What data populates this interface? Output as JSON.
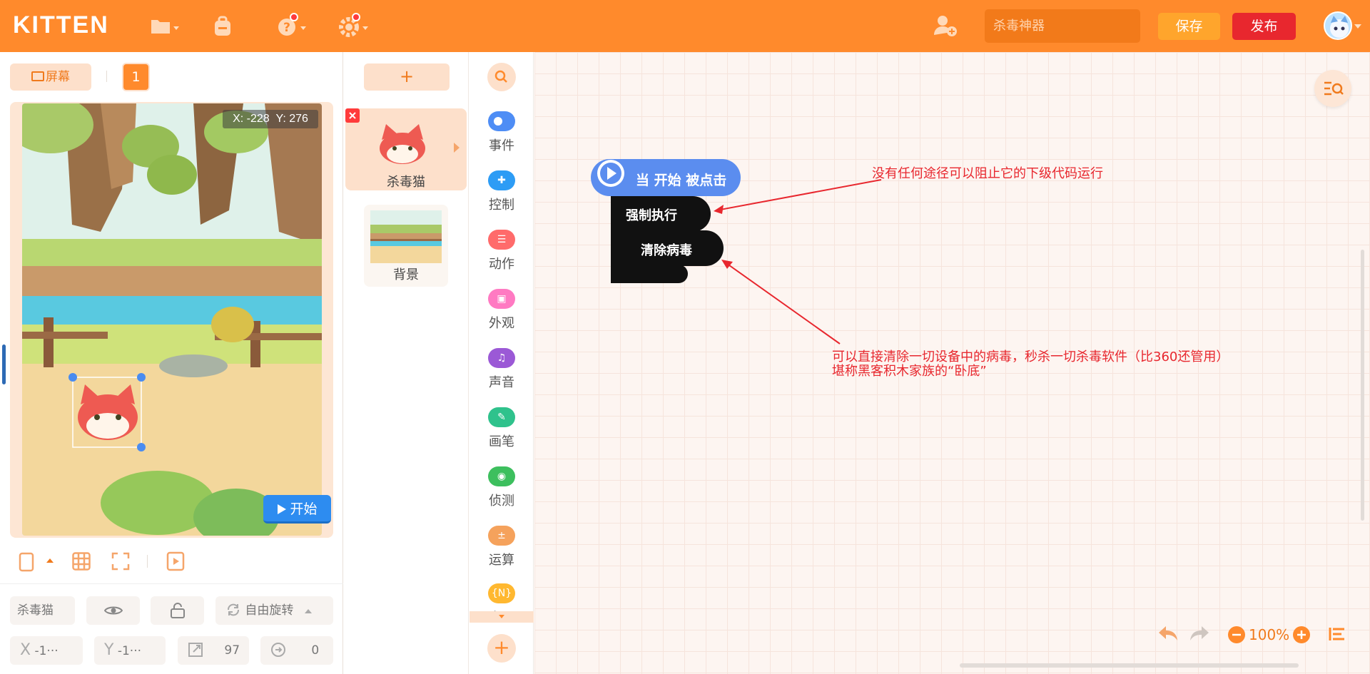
{
  "app": {
    "logo": "KITTEN",
    "project_name": "杀毒神器",
    "save_label": "保存",
    "publish_label": "发布"
  },
  "stage": {
    "screen_label": "屏幕",
    "screen_number": "1",
    "coord_x": "X: -228",
    "coord_y": "Y: 276",
    "start_label": "开始"
  },
  "sprite_props": {
    "name": "杀毒猫",
    "rotation_mode": "自由旋转",
    "x_label": "X",
    "x_value": "-1···",
    "y_label": "Y",
    "y_value": "-1···",
    "size": "97",
    "direction": "0"
  },
  "sprites": {
    "add_label": "+",
    "sprite_name": "杀毒猫",
    "background_name": "背景"
  },
  "categories": [
    "事件",
    "控制",
    "动作",
    "外观",
    "声音",
    "画笔",
    "侦测",
    "运算",
    "变量"
  ],
  "category_colors": [
    "#4e8df5",
    "#2d9cf5",
    "#ff6b6b",
    "#ff7ac2",
    "#9b59d6",
    "#2fc28c",
    "#3dbf5e",
    "#f5a25c",
    "#ffb830"
  ],
  "blocks": {
    "hat": "当 开始 被点击",
    "force_exec": "强制执行",
    "clear_virus": "清除病毒"
  },
  "notes": {
    "note1": "没有任何途径可以阻止它的下级代码运行",
    "note2_line1": "可以直接清除一切设备中的病毒，秒杀一切杀毒软件（比360还管用）",
    "note2_line2": "堪称黑客积木家族的“卧底”"
  },
  "zoom": {
    "level": "100%"
  }
}
